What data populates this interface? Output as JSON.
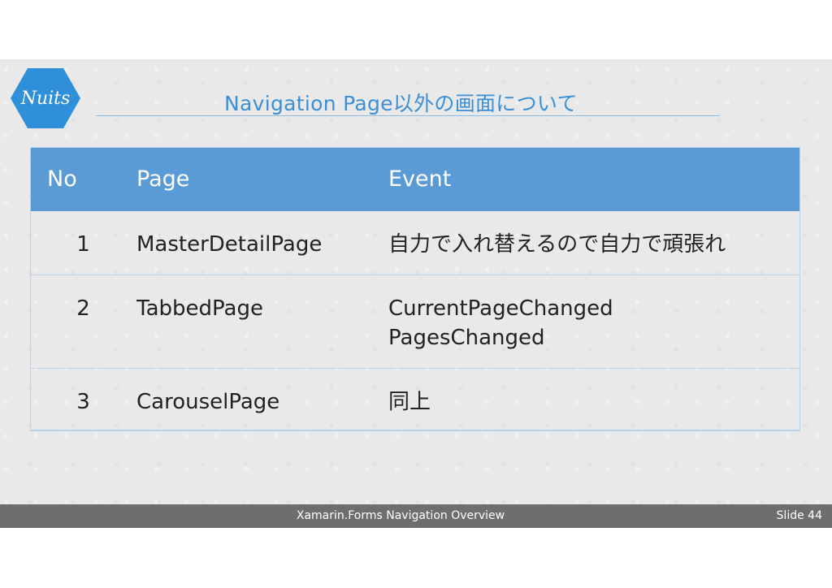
{
  "slide": {
    "logo_text": "Nuits",
    "title": "Navigation Page以外の画面について",
    "colors": {
      "accent": "#3a8fd6",
      "header_bg": "#5a9bd6",
      "footer_bg": "#6e6e6e",
      "logo_bg": "#2f8fd8"
    }
  },
  "table": {
    "headers": {
      "no": "No",
      "page": "Page",
      "event": "Event"
    },
    "rows": [
      {
        "no": "1",
        "page": "MasterDetailPage",
        "event_line1": "自力で入れ替えるので自力で頑張れ",
        "event_line2": ""
      },
      {
        "no": "2",
        "page": "TabbedPage",
        "event_line1": "CurrentPageChanged",
        "event_line2": "PagesChanged"
      },
      {
        "no": "3",
        "page": "CarouselPage",
        "event_line1": "同上",
        "event_line2": ""
      }
    ]
  },
  "footer": {
    "text": "Xamarin.Forms Navigation Overview",
    "slide_label": "Slide",
    "slide_number": "44"
  }
}
